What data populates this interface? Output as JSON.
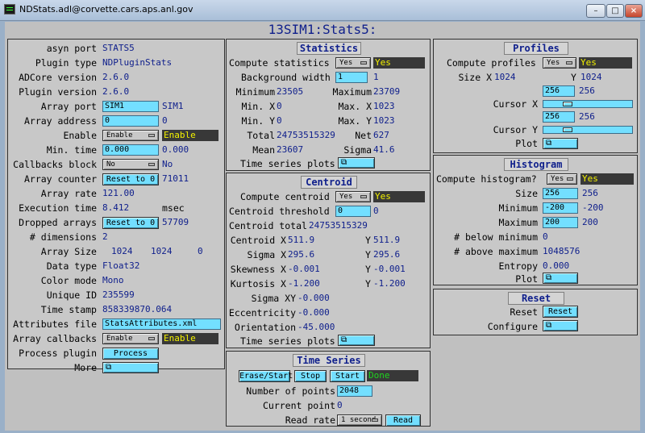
{
  "window": {
    "title": "NDStats.adl@corvette.cars.aps.anl.gov",
    "min": "–",
    "max": "□",
    "close": "×"
  },
  "screen_title": "13SIM1:Stats5:",
  "left": {
    "asyn_port_label": "asyn port",
    "asyn_port": "STATS5",
    "plugin_type_label": "Plugin type",
    "plugin_type": "NDPluginStats",
    "adcore_version_label": "ADCore version",
    "adcore_version": "2.6.0",
    "plugin_version_label": "Plugin version",
    "plugin_version": "2.6.0",
    "array_port_label": "Array port",
    "array_port_input": "SIM1",
    "array_port_rbv": "SIM1",
    "array_address_label": "Array address",
    "array_address_input": "0",
    "array_address_rbv": "0",
    "enable_label": "Enable",
    "enable_menu": "Enable",
    "enable_status": "Enable",
    "min_time_label": "Min. time",
    "min_time_input": "0.000",
    "min_time_rbv": "0.000",
    "callbacks_block_label": "Callbacks block",
    "callbacks_block_menu": "No",
    "callbacks_block_rbv": "No",
    "array_counter_label": "Array counter",
    "array_counter_button": "Reset to 0",
    "array_counter": "71011",
    "array_rate_label": "Array rate",
    "array_rate": "121.00",
    "execution_time_label": "Execution time",
    "execution_time": "8.412",
    "execution_time_unit": "msec",
    "dropped_arrays_label": "Dropped arrays",
    "dropped_arrays_button": "Reset to 0",
    "dropped_arrays": "57709",
    "dimensions_label": "# dimensions",
    "dimensions": "2",
    "array_size_label": "Array Size",
    "array_size_x": "1024",
    "array_size_y": "1024",
    "array_size_z": "0",
    "data_type_label": "Data type",
    "data_type": "Float32",
    "color_mode_label": "Color mode",
    "color_mode": "Mono",
    "unique_id_label": "Unique ID",
    "unique_id": "235599",
    "time_stamp_label": "Time stamp",
    "time_stamp": "858339870.064",
    "attributes_file_label": "Attributes file",
    "attributes_file": "StatsAttributes.xml",
    "array_callbacks_label": "Array callbacks",
    "array_callbacks_menu": "Enable",
    "array_callbacks_status": "Enable",
    "process_plugin_label": "Process plugin",
    "process_button": "Process",
    "more_label": "More"
  },
  "statistics": {
    "title": "Statistics",
    "compute_label": "Compute statistics",
    "compute_menu": "Yes",
    "compute_status": "Yes",
    "background_width_label": "Background width",
    "background_width_input": "1",
    "background_width_rbv": "1",
    "minimum_label": "Minimum",
    "minimum": "23505",
    "maximum_label": "Maximum",
    "maximum": "23709",
    "min_x_label": "Min. X",
    "min_x": "0",
    "max_x_label": "Max. X",
    "max_x": "1023",
    "min_y_label": "Min. Y",
    "min_y": "0",
    "max_y_label": "Max. Y",
    "max_y": "1023",
    "total_label": "Total",
    "total": "24753515329",
    "net_label": "Net",
    "net": "627",
    "mean_label": "Mean",
    "mean": "23607",
    "sigma_label": "Sigma",
    "sigma": "41.6",
    "time_series_label": "Time series plots"
  },
  "centroid": {
    "title": "Centroid",
    "compute_label": "Compute centroid",
    "compute_menu": "Yes",
    "compute_status": "Yes",
    "threshold_label": "Centroid threshold",
    "threshold_input": "0",
    "threshold_rbv": "0",
    "total_label": "Centroid total",
    "total": "24753515329",
    "centroid_x_label": "Centroid X",
    "centroid_x": "511.9",
    "centroid_y_label": "Y",
    "centroid_y": "511.9",
    "sigma_x_label": "Sigma X",
    "sigma_x": "295.6",
    "sigma_y_label": "Y",
    "sigma_y": "295.6",
    "skewness_x_label": "Skewness X",
    "skewness_x": "-0.001",
    "skewness_y_label": "Y",
    "skewness_y": "-0.001",
    "kurtosis_x_label": "Kurtosis X",
    "kurtosis_x": "-1.200",
    "kurtosis_y_label": "Y",
    "kurtosis_y": "-1.200",
    "sigma_xy_label": "Sigma XY",
    "sigma_xy": "-0.000",
    "eccentricity_label": "Eccentricity",
    "eccentricity": "-0.000",
    "orientation_label": "Orientation",
    "orientation": "-45.000",
    "time_series_label": "Time series plots"
  },
  "time_series": {
    "title": "Time Series",
    "erase_start": "Erase/Start",
    "stop": "Stop",
    "start": "Start",
    "status": "Done",
    "num_points_label": "Number of points",
    "num_points": "2048",
    "current_point_label": "Current point",
    "current_point": "0",
    "read_rate_label": "Read rate",
    "read_rate_menu": "1 second",
    "read_button": "Read"
  },
  "profiles": {
    "title": "Profiles",
    "compute_label": "Compute profiles",
    "compute_menu": "Yes",
    "compute_status": "Yes",
    "size_x_label": "Size X",
    "size_x": "1024",
    "size_y_label": "Y",
    "size_y": "1024",
    "cursor_x_label": "Cursor X",
    "cursor_x_input": "256",
    "cursor_x_rbv": "256",
    "cursor_x_fraction": 0.25,
    "cursor_y_label": "Cursor Y",
    "cursor_y_input": "256",
    "cursor_y_rbv": "256",
    "cursor_y_fraction": 0.25,
    "plot_label": "Plot"
  },
  "histogram": {
    "title": "Histogram",
    "compute_label": "Compute histogram?",
    "compute_menu": "Yes",
    "compute_status": "Yes",
    "size_label": "Size",
    "size_input": "256",
    "size_rbv": "256",
    "minimum_label": "Minimum",
    "minimum_input": "-200",
    "minimum_rbv": "-200",
    "maximum_label": "Maximum",
    "maximum_input": "200",
    "maximum_rbv": "200",
    "below_label": "# below minimum",
    "below": "0",
    "above_label": "# above maximum",
    "above": "1048576",
    "entropy_label": "Entropy",
    "entropy": "0.000",
    "plot_label": "Plot"
  },
  "reset": {
    "title": "Reset",
    "reset_label": "Reset",
    "reset_button": "Reset",
    "configure_label": "Configure"
  },
  "icons": {
    "related_display": "related-display-icon"
  }
}
